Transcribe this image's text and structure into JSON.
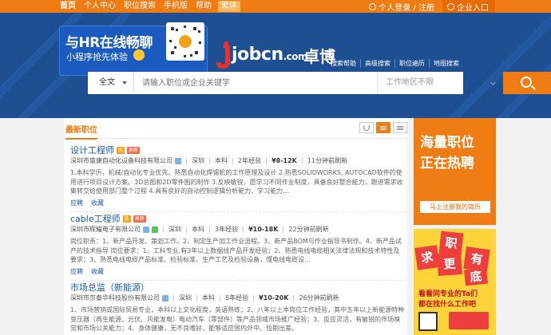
{
  "topnav": {
    "links": [
      "首页",
      "个人中心",
      "职位搜索",
      "手机版",
      "帮助"
    ],
    "tag": "繁体",
    "login": "个人登录 / 注册",
    "corp": "企业入口"
  },
  "banner": {
    "promo_title": "与HR在线畅聊",
    "promo_sub": "小程序抢先体验",
    "logo": "jobcn",
    "logo_com": ".com",
    "brand2": "卓博",
    "sublinks": [
      "搜索帮助",
      "高级搜索",
      "职位遍历",
      "地图搜索"
    ]
  },
  "search": {
    "category": "全文",
    "keyword_placeholder": "请输入职位或企业关键字",
    "location_placeholder": "工作地区不限"
  },
  "panel": {
    "tab": "最新职位"
  },
  "jobs": [
    {
      "title": "设计工程师",
      "badge1": "急",
      "badge2": "高薪",
      "company": "深圳市盛康自动化设备科技有限公司",
      "city": "深圳",
      "edu": "本科",
      "exp": "2年经验",
      "salary": "¥8-12K",
      "time": "11分钟前刷新",
      "desc": "1.本科学历，机械/自动化专业优先。熟悉自动化焊锡机的工作原理及设计 2.熟悉SOLIDWORKS, AUTOCAD软件的使用进行项目设计方案。3D总图和2D零件图的制作 3.反映敏锐，愿学习不同作业制度，具备良好整合能力，跟进需求收集转交给使用部门整个过程 4.具有良好的自动控制逻辑分析能力、学习能力…",
      "apply": "应聘",
      "save": "收藏"
    },
    {
      "title": "cable工程师",
      "badge1": "急",
      "badge2": "高薪",
      "company": "深圳市辉耀电子有限公司",
      "city": "深圳",
      "edu": "本科",
      "exp": "3年经验",
      "salary": "¥10-18K",
      "time": "22分钟前刷新",
      "desc": "岗位职责：1、新产品开发、策划工作。2、制定生产加工作业流程。3、新产品BOM与作业指导书制作。4、新产品试产的技术指导 岗位要求：1、工科专业,有3年以上数据线产品开发经验；2、熟悉电线电缆相关法律法规和技术特性及要求；3、熟悉电线电缆产品标准、检验标准、生产工艺及检验设备，懂电线电缆设…",
      "apply": "应聘",
      "save": "收藏"
    },
    {
      "title": "市场总监（新能源）",
      "badge1": "",
      "badge2": "",
      "company": "深圳市京泰华科技股份有限公司",
      "city": "深圳",
      "edu": "本科",
      "exp": "5年经验",
      "salary": "¥10-20K",
      "time": "26分钟前刷新",
      "desc": "1、市场营销或国际贸易专业，本科以上文化程度，英语熟练；2、八年以上本岗位工作经验，其中五年以上新能源特种变压器（再生能源、光伏、风能发电）电动汽车（零部件）等产品领域市场推广经验；3、反应灵活，有敏锐的市场嗅觉和市场公关能力；4、身体健康，无不良嗜好，能够适应国内外中、短期出差。",
      "apply": "应聘",
      "save": "收藏"
    }
  ],
  "ads": {
    "ad1_line1": "海量职位",
    "ad1_line2": "正在热聘",
    "ad1_button": "马上注册我的简历",
    "ad2_chars": [
      "求",
      "职",
      "更",
      "有",
      "底"
    ],
    "ad2_line1": "看看同专业的Ta们",
    "ad2_line2": "都在找什么工作吧"
  }
}
